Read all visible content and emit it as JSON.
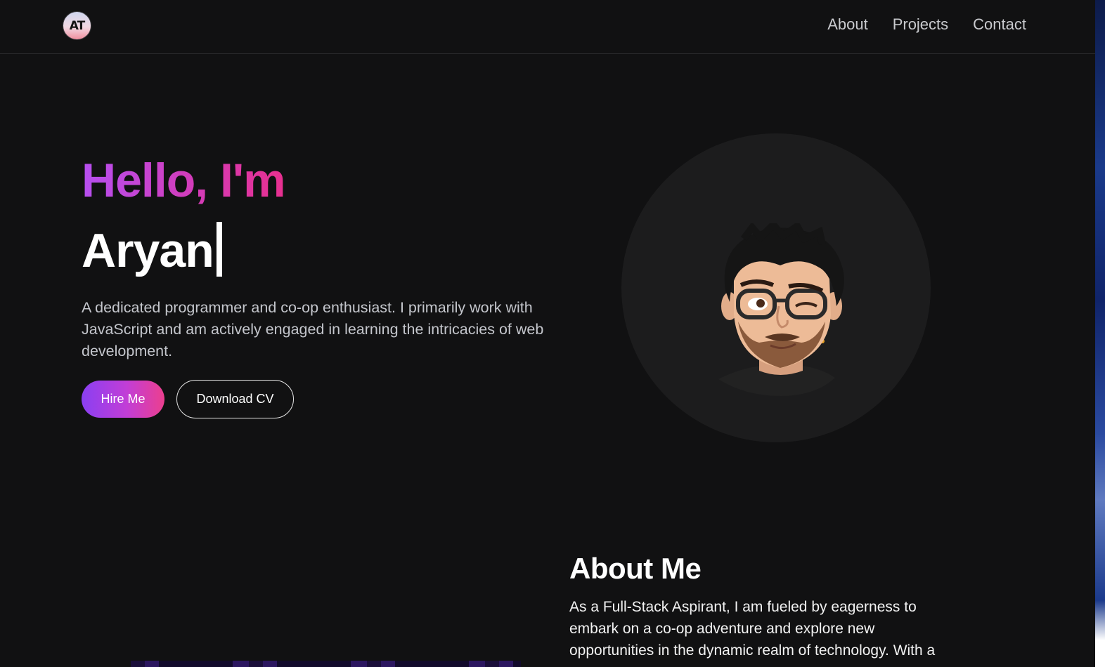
{
  "header": {
    "logo_text": "AT",
    "nav": [
      {
        "label": "About"
      },
      {
        "label": "Projects"
      },
      {
        "label": "Contact"
      }
    ]
  },
  "hero": {
    "greeting": "Hello, I'm",
    "name": "Aryan",
    "bio": "A dedicated programmer and co-op enthusiast. I primarily work with JavaScript and am actively engaged in learning the intricacies of web development.",
    "hire_label": "Hire Me",
    "cv_label": "Download CV"
  },
  "about": {
    "title": "About Me",
    "text": "As a Full-Stack Aspirant, I am fueled by eagerness to embark on a co-op adventure and explore new opportunities in the dynamic realm of technology. With a"
  },
  "colors": {
    "background": "#111112",
    "accent_start": "#8a3ff2",
    "accent_end": "#ec3f8e"
  }
}
